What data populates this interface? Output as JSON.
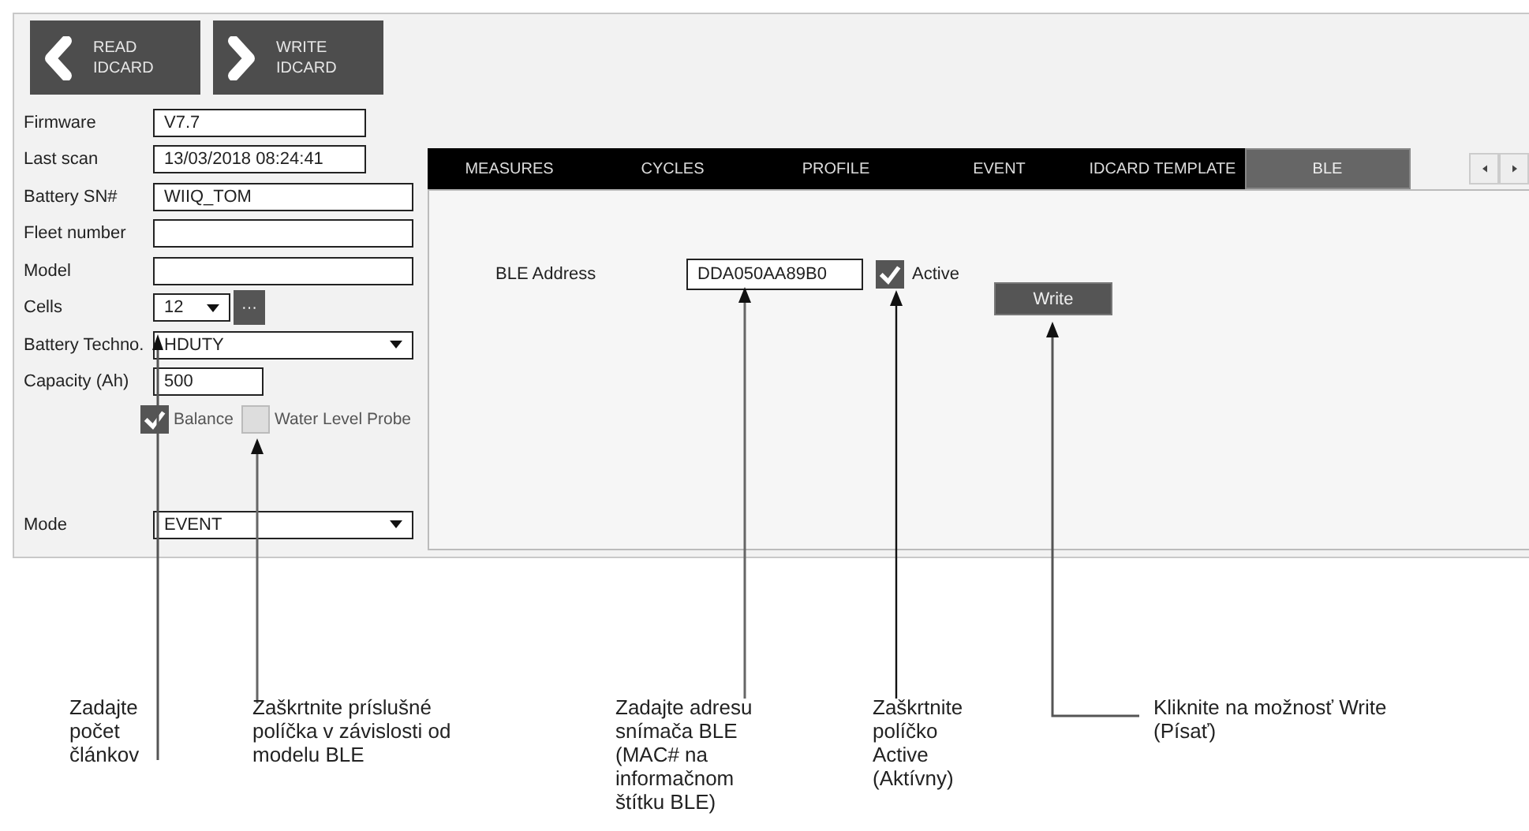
{
  "header_buttons": [
    {
      "kind": "back",
      "label": "READ IDCARD"
    },
    {
      "kind": "forward",
      "label": "WRITE IDCARD"
    }
  ],
  "fields": [
    {
      "label": "Firmware",
      "value": "V7.7",
      "kind": "short"
    },
    {
      "label": "Last scan",
      "value": "13/03/2018 08:24:41",
      "kind": "short"
    },
    {
      "label": "Battery SN#",
      "value": "WIIQ_TOM",
      "kind": "long"
    },
    {
      "label": "Fleet number",
      "kind": "long"
    },
    {
      "label": "Model",
      "kind": "long"
    },
    {
      "label": "Cells",
      "value": "12",
      "kind": "combo",
      "more": "···"
    },
    {
      "label": "Battery Techno.",
      "value": "HDUTY",
      "kind": "select"
    },
    {
      "label": "Capacity (Ah)",
      "value": "500",
      "kind": "medium"
    }
  ],
  "checkboxes": [
    {
      "label": "Balance",
      "checked": true
    },
    {
      "label": "Water Level Probe",
      "checked": false
    }
  ],
  "mode": {
    "label": "Mode",
    "value": "EVENT"
  },
  "tabs": [
    {
      "label": "MEASURES",
      "selected": false
    },
    {
      "label": "CYCLES",
      "selected": false
    },
    {
      "label": "PROFILE",
      "selected": false
    },
    {
      "label": "EVENT",
      "selected": false
    },
    {
      "label": "IDCARD TEMPLATE",
      "selected": false
    },
    {
      "label": "BLE",
      "selected": true
    }
  ],
  "ble": {
    "label": "BLE Address",
    "value": "DDA050AA89B0",
    "active_label": "Active",
    "active": true,
    "button": "Write"
  },
  "callouts": [
    {
      "text": "Zadajte počet článkov"
    },
    {
      "text": "Zaškrtnite príslušné políčka v závislosti od modelu BLE"
    },
    {
      "text": "Zadajte adresu snímača BLE (MAC# na informačnom štítku BLE)"
    },
    {
      "text": "Zaškrtnite políčko Active (Aktívny)"
    },
    {
      "text": "Kliknite na možnosť Write (Písať)"
    }
  ]
}
